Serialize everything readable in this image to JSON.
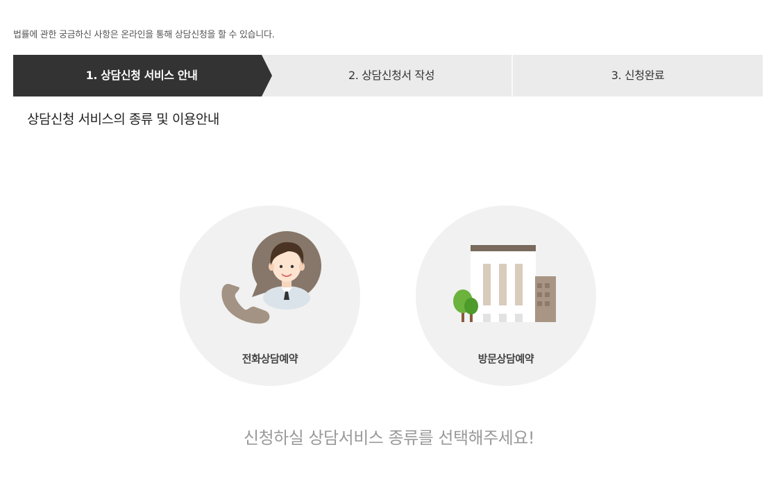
{
  "intro_text": "법률에 관한 궁금하신 사항은 온라인을 통해 상담신청을 할 수 있습니다.",
  "steps": [
    {
      "label": "1. 상담신청 서비스 안내",
      "active": true
    },
    {
      "label": "2. 상담신청서 작성",
      "active": false
    },
    {
      "label": "3. 신청완료",
      "active": false
    }
  ],
  "section_title": "상담신청 서비스의 종류 및 이용안내",
  "options": [
    {
      "label": "전화상담예약",
      "icon": "phone-consult-icon"
    },
    {
      "label": "방문상담예약",
      "icon": "building-visit-icon"
    }
  ],
  "prompt_text": "신청하실 상담서비스 종류를 선택해주세요!",
  "colors": {
    "active_step": "#333333",
    "step_bg": "#ebebeb",
    "circle_bg": "#f1f1f1",
    "prompt": "#999999"
  }
}
